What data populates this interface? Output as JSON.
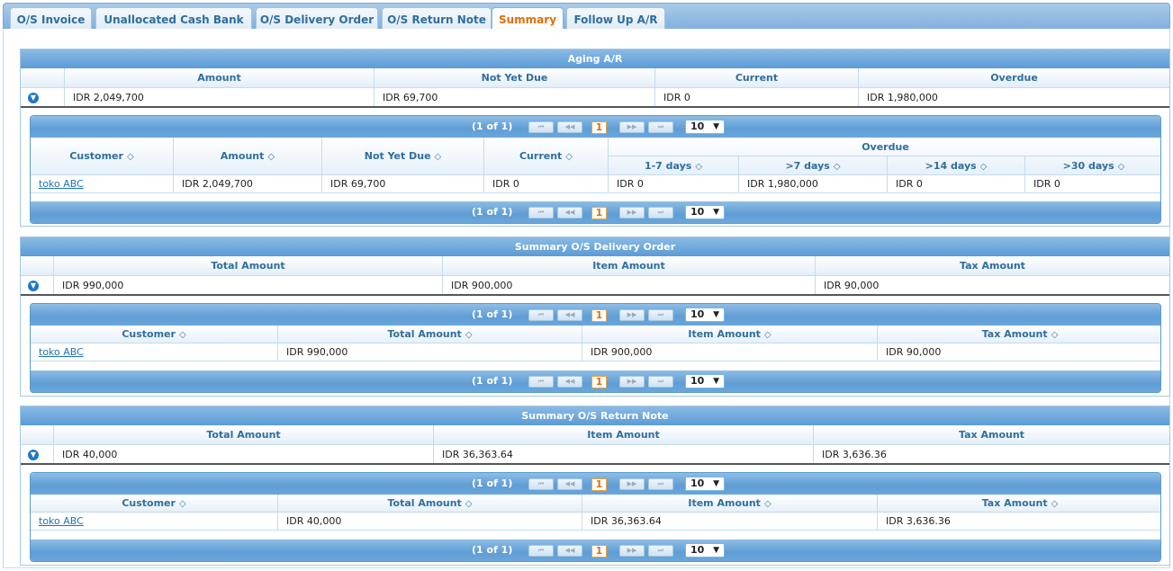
{
  "tabs": [
    {
      "label": "O/S Invoice"
    },
    {
      "label": "Unallocated Cash Bank In"
    },
    {
      "label": "O/S Delivery Order"
    },
    {
      "label": "O/S Return Note"
    },
    {
      "label": "Summary"
    },
    {
      "label": "Follow Up A/R"
    }
  ],
  "active_tab": "Summary",
  "aging": {
    "title": "Aging A/R",
    "headers": [
      "Amount",
      "Not Yet Due",
      "Current",
      "Overdue"
    ],
    "values": [
      "IDR 2,049,700",
      "IDR 69,700",
      "IDR 0",
      "IDR 1,980,000"
    ],
    "grid": {
      "pager": {
        "count": "(1 of 1)",
        "page": "1",
        "rows": "10"
      },
      "headers": [
        "Customer",
        "Amount",
        "Not Yet Due",
        "Current"
      ],
      "overdue_group": "Overdue",
      "overdue_headers": [
        "1-7 days",
        ">7 days",
        ">14 days",
        ">30 days"
      ],
      "rows": [
        [
          "toko ABC",
          "IDR 2,049,700",
          "IDR 69,700",
          "IDR 0",
          "IDR 0",
          "IDR 1,980,000",
          "IDR 0",
          "IDR 0"
        ]
      ]
    }
  },
  "delivery": {
    "title": "Summary O/S Delivery Order",
    "headers": [
      "Total Amount",
      "Item Amount",
      "Tax Amount"
    ],
    "values": [
      "IDR 990,000",
      "IDR 900,000",
      "IDR 90,000"
    ],
    "grid": {
      "pager": {
        "count": "(1 of 1)",
        "page": "1",
        "rows": "10"
      },
      "headers": [
        "Customer",
        "Total Amount",
        "Item Amount",
        "Tax Amount"
      ],
      "rows": [
        [
          "toko ABC",
          "IDR 990,000",
          "IDR 900,000",
          "IDR 90,000"
        ]
      ]
    }
  },
  "returns": {
    "title": "Summary O/S Return Note",
    "headers": [
      "Total Amount",
      "Item Amount",
      "Tax Amount"
    ],
    "values": [
      "IDR 40,000",
      "IDR 36,363.64",
      "IDR 3,636.36"
    ],
    "grid": {
      "pager": {
        "count": "(1 of 1)",
        "page": "1",
        "rows": "10"
      },
      "headers": [
        "Customer",
        "Total Amount",
        "Item Amount",
        "Tax Amount"
      ],
      "rows": [
        [
          "toko ABC",
          "IDR 40,000",
          "IDR 36,363.64",
          "IDR 3,636.36"
        ]
      ]
    }
  },
  "pager_icons": {
    "first": "⏮",
    "prev": "◀◀",
    "next": "▶▶",
    "last": "⏭"
  },
  "sort_icon": "◇",
  "colors": {
    "accent": "#e17009",
    "header_text": "#2e6e9e",
    "title_bar": "#5b9bd6"
  }
}
